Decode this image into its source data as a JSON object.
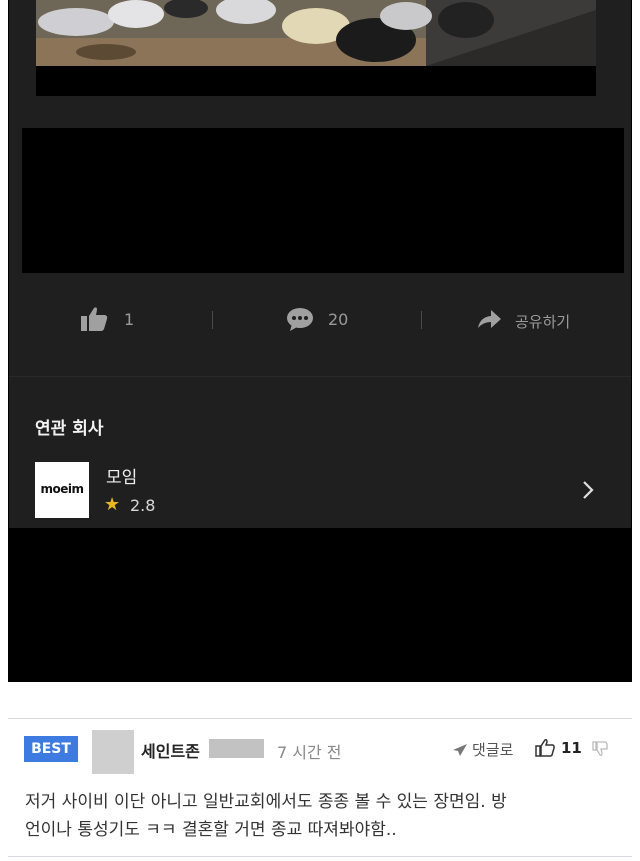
{
  "post": {
    "actions": {
      "like_count": "1",
      "comment_count": "20",
      "share_label": "공유하기"
    },
    "related": {
      "title": "연관 회사",
      "company": {
        "logo_text": "moeim",
        "name": "모임",
        "rating": "2.8",
        "star_icon": "star-icon"
      }
    }
  },
  "comment": {
    "badge": "BEST",
    "username": "세인트존",
    "time": "7 시간 전",
    "reply_label": "댓글로",
    "like_count": "11",
    "text_line1": "저거 사이비 이단 아니고 일반교회에서도 종종 볼 수 있는 장면임. 방",
    "text_line2": "언이나 통성기도 ㅋㅋ 결혼할 거면 종교 따져봐야함..",
    "colors": {
      "badge": "#3e7be0",
      "divider": "#d6d9e2"
    }
  },
  "theme": {
    "app_bg": "#1f1f1f",
    "star": "#e8b820"
  }
}
